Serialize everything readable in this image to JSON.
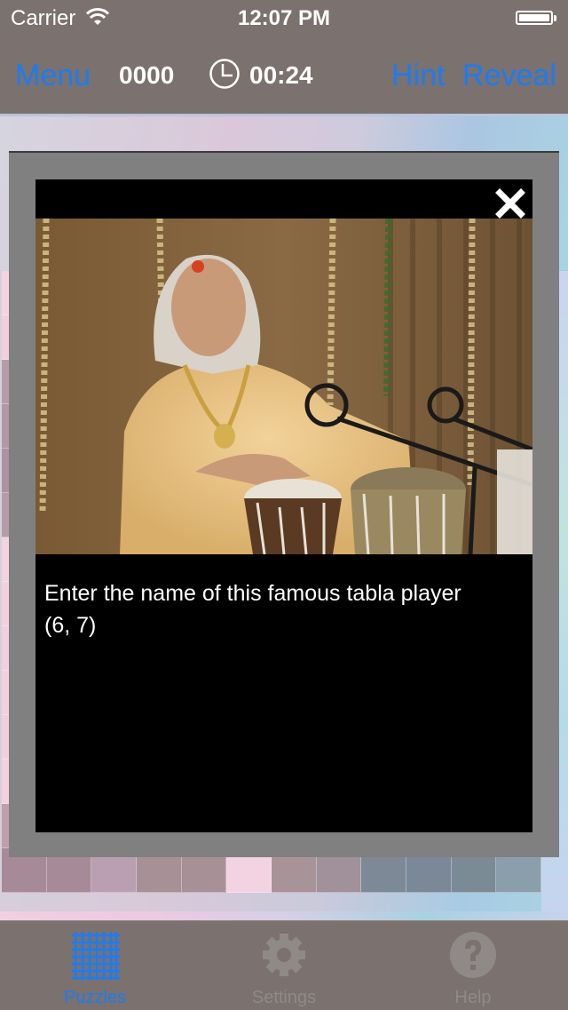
{
  "status_bar": {
    "carrier": "Carrier",
    "time": "12:07 PM"
  },
  "toolbar": {
    "menu_label": "Menu",
    "score": "0000",
    "timer": "00:24",
    "hint_label": "Hint",
    "reveal_label": "Reveal"
  },
  "colors": {
    "accent": "#1a7cf5",
    "bar_bg": "#7b716e",
    "modal_frame": "#808080",
    "inactive_tab": "#8f8a88"
  },
  "clue_dialog": {
    "photo_alt": "Elderly tabla player in golden kurta playing tabla with microphones",
    "clue_text": "Enter the name of this famous tabla player",
    "answer_lengths": "(6, 7)",
    "close_icon": "close-icon"
  },
  "board": {
    "rows": [
      [
        "#f5d3e1",
        "#f2d2df",
        "#f0d6e0",
        "#f4d5e0",
        "#e8d6e2",
        "#e6dde6",
        "#bfc6d6",
        "#b7c8dd",
        "#b3cbe0",
        "#aacde1",
        "#b4d6e4",
        "#b2d4e4"
      ],
      [
        "#f3cfdd",
        "#f2d0dd",
        "#f0d3de",
        "#f4d3df",
        "#ead3e0",
        "#e5d7e2",
        "#c8c6d6",
        "#bac8dc",
        "#b5cde0",
        "#acd0e2",
        "#bcdde4",
        "#b6d4e4"
      ],
      [
        "#b69ca9",
        "#b9a2b0",
        "#ad9aa6",
        "#ad9aa7",
        "#f1d6e4",
        "#a9959f",
        "#a5939c",
        "#8f98a7",
        "#8c9cae",
        "#8a9db1",
        "#8ea5b3",
        "#93a4b6"
      ],
      [
        "#b297a6",
        "#b99fb3",
        "#a8949f",
        "#a8939f",
        "#eed2e1",
        "#a6929c",
        "#a1929d",
        "#8897a4",
        "#8798ac",
        "#879cb0",
        "#8ea4b2",
        "#8d9db2"
      ],
      [
        "#ac92a3",
        "#b49dae",
        "#a9939f",
        "#a8939f",
        "#eccfdf",
        "#a9959e",
        "#a2929b",
        "#86939f",
        "#8695a8",
        "#8799ac",
        "#8ba1b0",
        "#8b9bb0"
      ],
      [
        "#b69ba8",
        "#bca6b2",
        "#aa97a1",
        "#aa96a1",
        "#eed3e1",
        "#a8959d",
        "#a1939c",
        "#87949f",
        "#8795a7",
        "#8699ab",
        "#8ca2b0",
        "#8a9aaf"
      ],
      [
        "#f4d3e0",
        "#f2d2e0",
        "#f1d5df",
        "#f3d5e0",
        "#ebd6e3",
        "#e6dae4",
        "#c2c3d3",
        "#b4c3d8",
        "#b2c8dd",
        "#a8cadf",
        "#b4d6e2",
        "#b2d3e3"
      ],
      [
        "#f4d0df",
        "#f3d1df",
        "#f1d3df",
        "#f3d3df",
        "#eed4e2",
        "#e6d9e3",
        "#c1c3d3",
        "#b3c3d7",
        "#b1c7dc",
        "#a7c9de",
        "#b3d4e2",
        "#b1d2e2"
      ],
      [
        "#f1cfde",
        "#f2d0de",
        "#f0d3de",
        "#f3d3df",
        "#ecd2e0",
        "#e4d8e2",
        "#bfc2d3",
        "#b1c1d6",
        "#afc5db",
        "#a5c7dd",
        "#b1d3e2",
        "#afd0e1"
      ],
      [
        "#f3d0dd",
        "#f2d0de",
        "#f0d2dd",
        "#f3d3df",
        "#ead3e0",
        "#e5d8e2",
        "#c0c2d3",
        "#b2c2d7",
        "#b0c6dc",
        "#a6c8de",
        "#b2d4e2",
        "#b0d1e2"
      ],
      [
        "#f2cfdd",
        "#f1cfdd",
        "#efd2dd",
        "#f2d2de",
        "#e9d2df",
        "#e4d7e1",
        "#bfc1d2",
        "#b1c1d6",
        "#afc5db",
        "#a5c7dd",
        "#b1d3e1",
        "#afd0e1"
      ],
      [
        "#f3d1de",
        "#f3d1de",
        "#f1d4de",
        "#f3d4df",
        "#ebd4e1",
        "#e6d9e3",
        "#c1c3d4",
        "#b3c3d8",
        "#b1c7dc",
        "#a7c9de",
        "#b3d5e3",
        "#b1d2e3"
      ],
      [
        "#be9fab",
        "#f1cfdf",
        "#f1d1df",
        "#f3dde2",
        "#f3d1df",
        "#eadbe3",
        "#e7e1e7",
        "#a89fab",
        "#7a8b97",
        "#8b9dab",
        "#778a95",
        "#c3dec0"
      ],
      [
        "#a78a98",
        "#a78a98",
        "#b99fb1",
        "#a79196",
        "#a79196",
        "#f3d2e2",
        "#a79398",
        "#a0919a",
        "#7d8996",
        "#7a8898",
        "#7a8b95",
        "#8a9fab"
      ]
    ]
  },
  "tab_bar": {
    "tabs": [
      {
        "label": "Puzzles",
        "icon": "grid-icon",
        "active": true
      },
      {
        "label": "Settings",
        "icon": "gear-icon",
        "active": false
      },
      {
        "label": "Help",
        "icon": "question-icon",
        "active": false
      }
    ]
  }
}
